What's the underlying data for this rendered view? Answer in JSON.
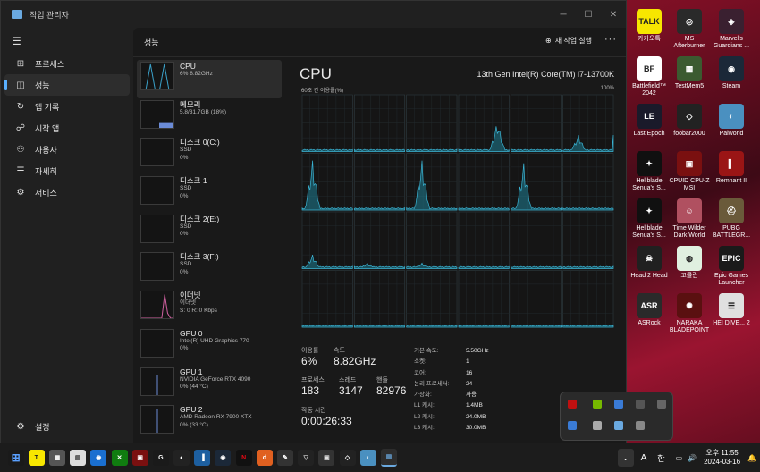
{
  "window": {
    "title": "작업 관리자"
  },
  "nav": {
    "items": [
      {
        "label": "프로세스",
        "icon": "grid-icon"
      },
      {
        "label": "성능",
        "icon": "performance-icon"
      },
      {
        "label": "앱 기록",
        "icon": "history-icon"
      },
      {
        "label": "시작 앱",
        "icon": "startup-icon"
      },
      {
        "label": "사용자",
        "icon": "users-icon"
      },
      {
        "label": "자세히",
        "icon": "list-icon"
      },
      {
        "label": "서비스",
        "icon": "services-icon"
      }
    ],
    "settings": "설정"
  },
  "header": {
    "title": "성능",
    "new_task": "새 작업 실행"
  },
  "devices": [
    {
      "name": "CPU",
      "sub1": "6% 8.82GHz",
      "sub2": "",
      "sub3": ""
    },
    {
      "name": "메모리",
      "sub1": "5.8/31.7GB (18%)",
      "sub2": "",
      "sub3": ""
    },
    {
      "name": "디스크 0(C:)",
      "sub1": "SSD",
      "sub2": "0%",
      "sub3": ""
    },
    {
      "name": "디스크 1",
      "sub1": "SSD",
      "sub2": "0%",
      "sub3": ""
    },
    {
      "name": "디스크 2(E:)",
      "sub1": "SSD",
      "sub2": "0%",
      "sub3": ""
    },
    {
      "name": "디스크 3(F:)",
      "sub1": "SSD",
      "sub2": "0%",
      "sub3": ""
    },
    {
      "name": "이더넷",
      "sub1": "이더넷",
      "sub2": "S: 0 R: 0 Kbps",
      "sub3": ""
    },
    {
      "name": "GPU 0",
      "sub1": "Intel(R) UHD Graphics 770",
      "sub2": "0%",
      "sub3": ""
    },
    {
      "name": "GPU 1",
      "sub1": "NVIDIA GeForce RTX 4090",
      "sub2": "0% (44 °C)",
      "sub3": ""
    },
    {
      "name": "GPU 2",
      "sub1": "AMD Radeon RX 7900 XTX",
      "sub2": "0% (33 °C)",
      "sub3": ""
    }
  ],
  "cpu": {
    "title": "CPU",
    "model": "13th Gen Intel(R) Core(TM) i7-13700K",
    "graph_label": "60초 간 이용률(%)",
    "graph_max": "100%",
    "usage_label": "이용률",
    "usage": "6%",
    "speed_label": "속도",
    "speed": "8.82GHz",
    "proc_label": "프로세스",
    "proc": "183",
    "threads_label": "스레드",
    "threads": "3147",
    "handles_label": "핸들",
    "handles": "82976",
    "uptime_label": "작동 시간",
    "uptime": "0:00:26:33",
    "details": [
      {
        "k": "기본 속도:",
        "v": "5.50GHz"
      },
      {
        "k": "소켓:",
        "v": "1"
      },
      {
        "k": "코어:",
        "v": "16"
      },
      {
        "k": "논리 프로세서:",
        "v": "24"
      },
      {
        "k": "가상화:",
        "v": "사용"
      },
      {
        "k": "L1 캐시:",
        "v": "1.4MB"
      },
      {
        "k": "L2 캐시:",
        "v": "24.0MB"
      },
      {
        "k": "L3 캐시:",
        "v": "30.0MB"
      }
    ]
  },
  "desktop_icons": [
    {
      "label": "카카오톡",
      "color": "#f7e600",
      "glyph": "TALK"
    },
    {
      "label": "MS Afterburner",
      "color": "#2a2a2a",
      "glyph": "◎"
    },
    {
      "label": "Marvel's Guardians ...",
      "color": "#3a2030",
      "glyph": "◈"
    },
    {
      "label": "Battlefield™ 2042",
      "color": "#ffffff",
      "glyph": "BF"
    },
    {
      "label": "TestMem5",
      "color": "#3b5a30",
      "glyph": "▦"
    },
    {
      "label": "Steam",
      "color": "#1b2838",
      "glyph": "◉"
    },
    {
      "label": "Last Epoch",
      "color": "#1a1a2a",
      "glyph": "LE"
    },
    {
      "label": "foobar2000",
      "color": "#222",
      "glyph": "◇"
    },
    {
      "label": "Palworld",
      "color": "#4a90c0",
      "glyph": "◐"
    },
    {
      "label": "Hellblade Senua's S...",
      "color": "#101010",
      "glyph": "✦"
    },
    {
      "label": "CPUID CPU-Z MSI",
      "color": "#7a1010",
      "glyph": "▣"
    },
    {
      "label": "Remnant II",
      "color": "#9a1515",
      "glyph": "▌"
    },
    {
      "label": "Hellblade Senua's S...",
      "color": "#101010",
      "glyph": "✦"
    },
    {
      "label": "Time Wilder Dark World",
      "color": "#b05060",
      "glyph": "☺"
    },
    {
      "label": "PUBG BATTLEGR...",
      "color": "#6a5a3a",
      "glyph": "⛑"
    },
    {
      "label": "Head 2 Head",
      "color": "#202020",
      "glyph": "☠"
    },
    {
      "label": "고클린",
      "color": "#e0f0e0",
      "glyph": "◍"
    },
    {
      "label": "Epic Games Launcher",
      "color": "#1a1a1a",
      "glyph": "EPIC"
    },
    {
      "label": "ASRock",
      "color": "#2a2a2a",
      "glyph": "ASR"
    },
    {
      "label": "NARAKA BLADEPOINT",
      "color": "#5a1010",
      "glyph": "✺"
    },
    {
      "label": "HEI DIVE... 2",
      "color": "#e0e0e0",
      "glyph": "☰"
    }
  ],
  "taskbar": {
    "time": "오후 11:55",
    "date": "2024-03-16",
    "ime": "A",
    "lang": "한"
  }
}
